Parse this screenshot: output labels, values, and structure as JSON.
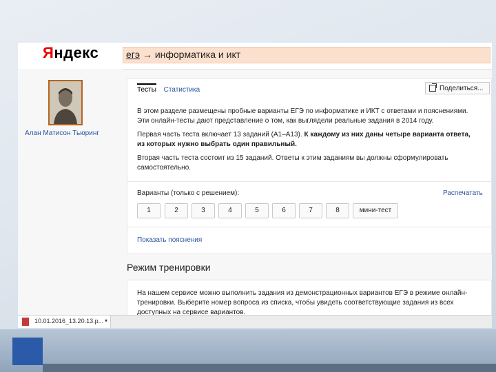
{
  "header": {
    "logo_first": "Я",
    "logo_rest": "ндекс",
    "query_underlined": "егэ",
    "query_rest": " → информатика и икт"
  },
  "sidebar": {
    "person_name": "Алан Матисон Тьюринг"
  },
  "tabs": [
    {
      "label": "Тесты",
      "active": true
    },
    {
      "label": "Статистика",
      "active": false
    }
  ],
  "share_button": "Поделиться...",
  "intro": {
    "p1": "В этом разделе размещены пробные варианты ЕГЭ по информатике и ИКТ с ответами и пояснениями. Эти онлайн-тесты дают представление о том, как выглядели реальные задания в 2014 году.",
    "p2_normal": "Первая часть теста включает 13 заданий (А1–А13). ",
    "p2_bold": "К каждому из них даны четыре варианта ответа, из которых нужно выбрать один правильный.",
    "p3": "Вторая часть теста состоит из 15 заданий. Ответы к этим заданиям вы должны сформулировать самостоятельно."
  },
  "variants": {
    "label": "Варианты (только с решением):",
    "print_link": "Распечатать",
    "buttons": [
      "1",
      "2",
      "3",
      "4",
      "5",
      "6",
      "7",
      "8"
    ],
    "mini_test": "мини-тест"
  },
  "explain_link": "Показать пояснения",
  "training": {
    "title": "Режим тренировки",
    "text": "На нашем сервисе можно выполнить задания из демонстрационных вариантов ЕГЭ в режиме онлайн-тренировки. Выберите номер вопроса из списка, чтобы увидеть соответствующие задания из всех доступных на сервисе вариантов."
  },
  "taskbar": {
    "download_name": "10.01.2016_13.20.13.p..."
  },
  "colors": {
    "accent_link": "#2b55a0",
    "search_bg": "#fbe0ce",
    "logo_red": "#e00000"
  }
}
